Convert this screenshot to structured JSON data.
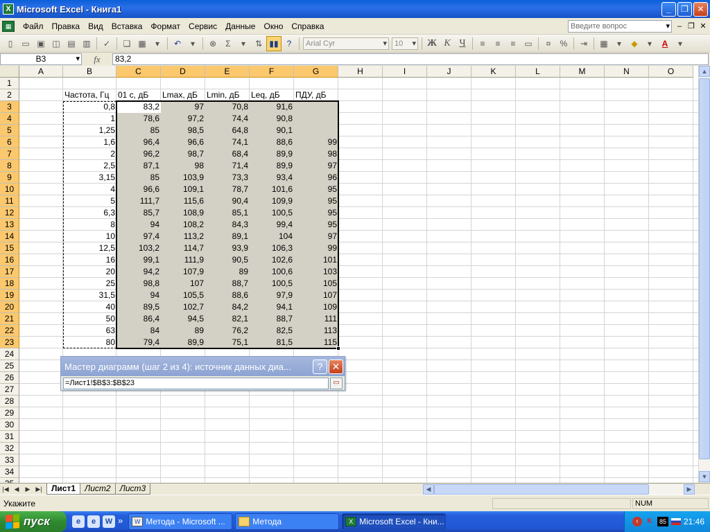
{
  "window": {
    "title": "Microsoft Excel - Книга1",
    "app_icon": "excel-icon"
  },
  "menu": {
    "items": [
      "Файл",
      "Правка",
      "Вид",
      "Вставка",
      "Формат",
      "Сервис",
      "Данные",
      "Окно",
      "Справка"
    ],
    "help_placeholder": "Введите вопрос"
  },
  "toolbar": {
    "font_name": "Arial Cyr",
    "font_size": "10",
    "bold_label": "Ж",
    "italic_label": "К",
    "underline_label": "Ч",
    "autosum_label": "Σ",
    "percent_label": "%"
  },
  "formula_bar": {
    "name_box": "B3",
    "fx_label": "fx",
    "content": "83,2"
  },
  "grid": {
    "columns": [
      "A",
      "B",
      "C",
      "D",
      "E",
      "F",
      "G",
      "H",
      "I",
      "J",
      "K",
      "L",
      "M",
      "N",
      "O"
    ],
    "selected_columns": [
      "C",
      "D",
      "E",
      "F",
      "G"
    ],
    "rows": [
      "1",
      "2",
      "3",
      "4",
      "5",
      "6",
      "7",
      "8",
      "9",
      "10",
      "11",
      "12",
      "13",
      "14",
      "15",
      "16",
      "17",
      "18",
      "19",
      "20",
      "21",
      "22",
      "23",
      "24",
      "25",
      "26",
      "27",
      "28",
      "29",
      "30",
      "31",
      "32",
      "33",
      "34",
      "35"
    ],
    "selected_rows": [
      "3",
      "4",
      "5",
      "6",
      "7",
      "8",
      "9",
      "10",
      "11",
      "12",
      "13",
      "14",
      "15",
      "16",
      "17",
      "18",
      "19",
      "20",
      "21",
      "22",
      "23"
    ],
    "headers": [
      "Частота, Гц",
      "01 с, дБ",
      "Lmax, дБ",
      "Lmin, дБ",
      "Leq, дБ",
      "ПДУ, дБ"
    ],
    "data": [
      [
        "0,8",
        "83,2",
        "97",
        "70,8",
        "91,6",
        ""
      ],
      [
        "1",
        "78,6",
        "97,2",
        "74,4",
        "90,8",
        ""
      ],
      [
        "1,25",
        "85",
        "98,5",
        "64,8",
        "90,1",
        ""
      ],
      [
        "1,6",
        "96,4",
        "96,6",
        "74,1",
        "88,6",
        "99"
      ],
      [
        "2",
        "96,2",
        "98,7",
        "68,4",
        "89,9",
        "98"
      ],
      [
        "2,5",
        "87,1",
        "98",
        "71,4",
        "89,9",
        "97"
      ],
      [
        "3,15",
        "85",
        "103,9",
        "73,3",
        "93,4",
        "96"
      ],
      [
        "4",
        "96,6",
        "109,1",
        "78,7",
        "101,6",
        "95"
      ],
      [
        "5",
        "111,7",
        "115,6",
        "90,4",
        "109,9",
        "95"
      ],
      [
        "6,3",
        "85,7",
        "108,9",
        "85,1",
        "100,5",
        "95"
      ],
      [
        "8",
        "94",
        "108,2",
        "84,3",
        "99,4",
        "95"
      ],
      [
        "10",
        "97,4",
        "113,2",
        "89,1",
        "104",
        "97"
      ],
      [
        "12,5",
        "103,2",
        "114,7",
        "93,9",
        "106,3",
        "99"
      ],
      [
        "16",
        "99,1",
        "111,9",
        "90,5",
        "102,6",
        "101"
      ],
      [
        "20",
        "94,2",
        "107,9",
        "89",
        "100,6",
        "103"
      ],
      [
        "25",
        "98,8",
        "107",
        "88,7",
        "100,5",
        "105"
      ],
      [
        "31,5",
        "94",
        "105,5",
        "88,6",
        "97,9",
        "107"
      ],
      [
        "40",
        "89,5",
        "102,7",
        "84,2",
        "94,1",
        "109"
      ],
      [
        "50",
        "86,4",
        "94,5",
        "82,1",
        "88,7",
        "111"
      ],
      [
        "63",
        "84",
        "89",
        "76,2",
        "82,5",
        "113"
      ],
      [
        "80",
        "79,4",
        "89,9",
        "75,1",
        "81,5",
        "115"
      ]
    ]
  },
  "wizard": {
    "title": "Мастер диаграмм (шаг 2 из 4): источник данных диа...",
    "help_label": "?",
    "close_label": "✕",
    "range_value": "=Лист1!$B$3:$B$23"
  },
  "sheets": {
    "tabs": [
      "Лист1",
      "Лист2",
      "Лист3"
    ],
    "active": "Лист1"
  },
  "status": {
    "text": "Укажите",
    "num_indicator": "NUM"
  },
  "taskbar": {
    "start_label": "пуск",
    "tasks": [
      {
        "label": "Метода - Microsoft ...",
        "icon": "word-doc-icon"
      },
      {
        "label": "Метода",
        "icon": "folder-icon"
      },
      {
        "label": "Microsoft Excel - Кни...",
        "icon": "excel-icon"
      }
    ],
    "tray_number": "85",
    "clock": "21:46"
  },
  "colors": {
    "selection_fill": "#d3d0c5",
    "header_highlight": "#fbc86e",
    "taskbar_blue": "#245edb",
    "start_green": "#2f8a2f"
  }
}
